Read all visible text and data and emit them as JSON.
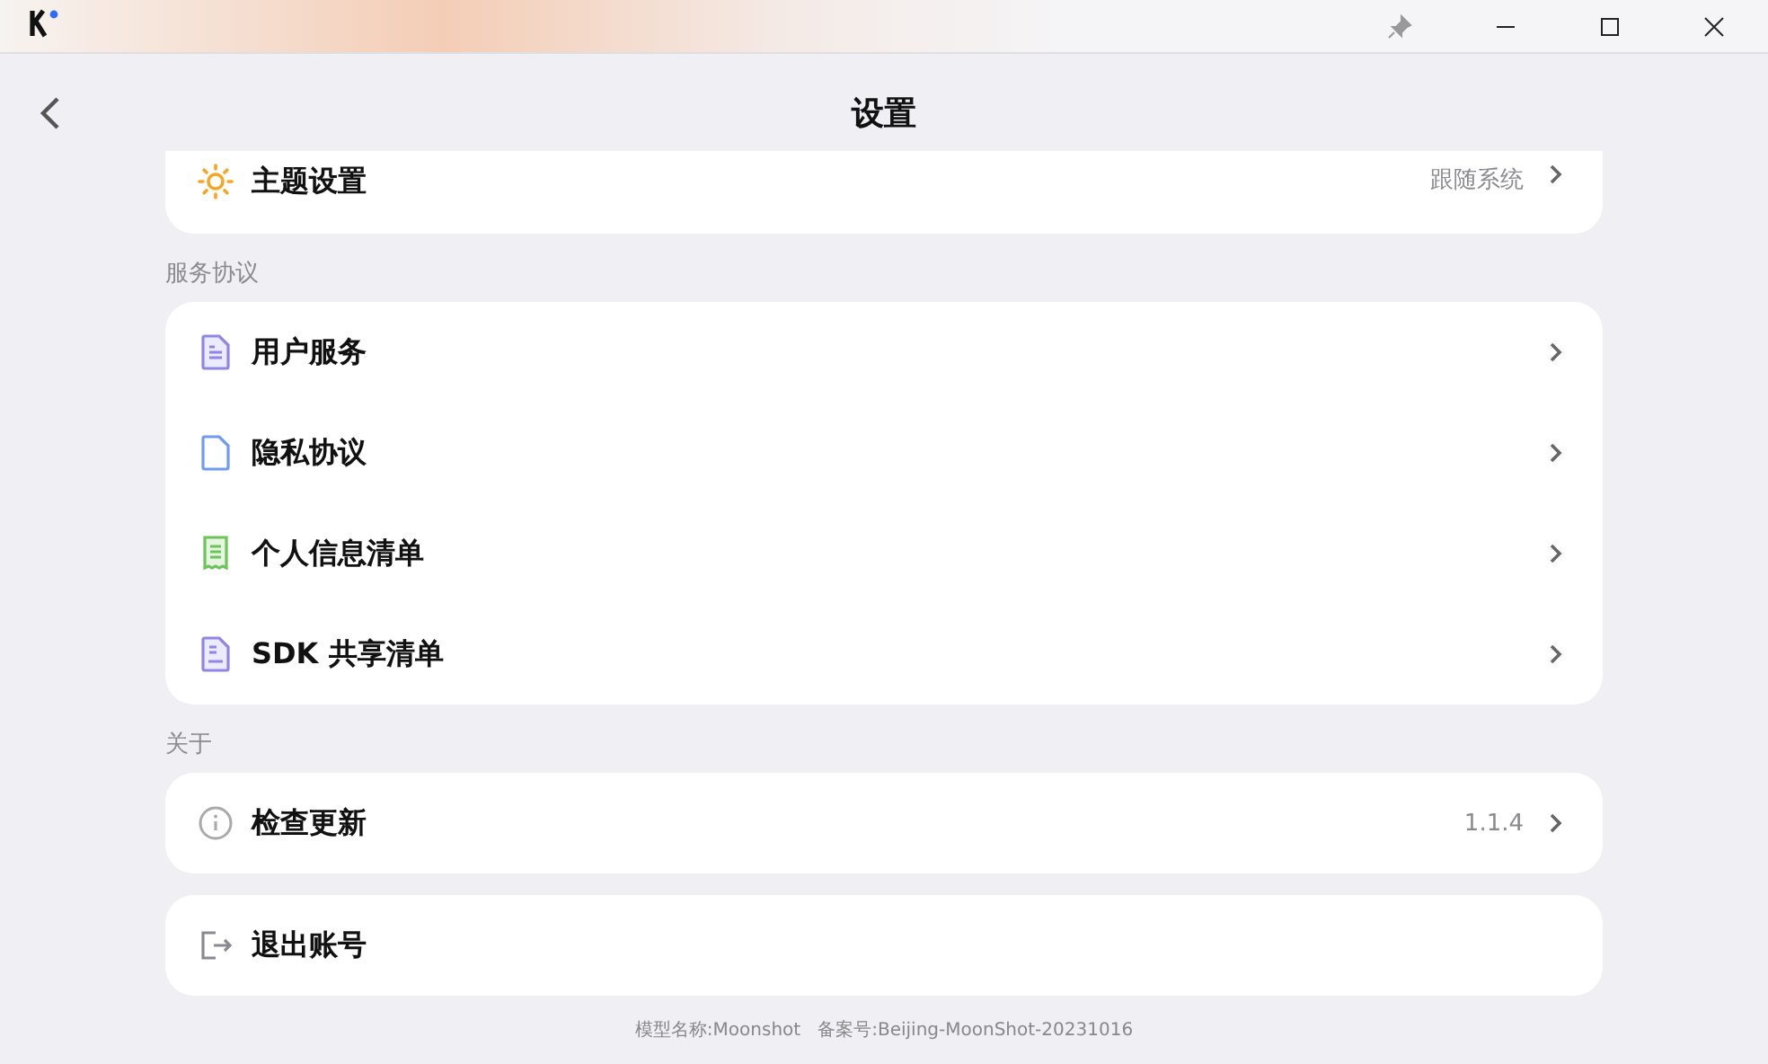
{
  "header": {
    "title": "设置"
  },
  "sections": [
    {
      "rows": [
        {
          "kind": "link",
          "label": "主题设置",
          "value": "跟随系统"
        }
      ]
    },
    {
      "label": "服务协议",
      "rows": [
        {
          "kind": "link",
          "label": "用户服务"
        },
        {
          "kind": "link",
          "label": "隐私协议"
        },
        {
          "kind": "link",
          "label": "个人信息清单"
        },
        {
          "kind": "link",
          "label": "SDK 共享清单"
        }
      ]
    },
    {
      "label": "关于",
      "rows": [
        {
          "kind": "link",
          "label": "检查更新",
          "value": "1.1.4"
        }
      ]
    },
    {
      "rows": [
        {
          "kind": "action",
          "label": "退出账号"
        }
      ]
    }
  ],
  "footer": "模型名称:Moonshot   备案号:Beijing-MoonShot-20231016"
}
